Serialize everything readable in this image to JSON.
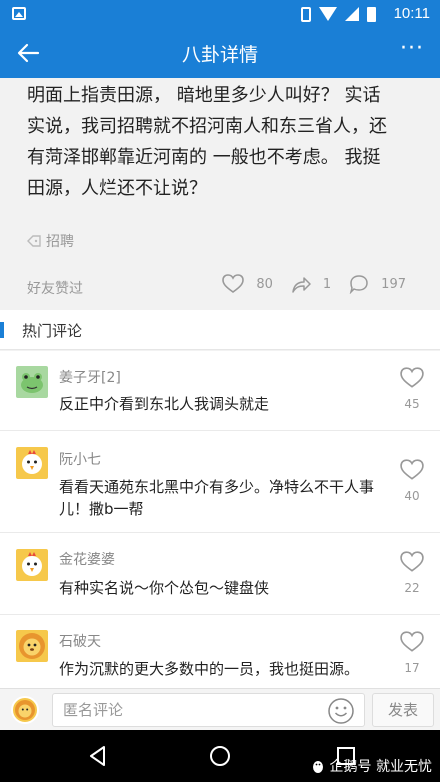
{
  "status_bar": {
    "time": "10:11"
  },
  "app_bar": {
    "title": "八卦详情",
    "more_label": "···"
  },
  "post": {
    "body": "明面上指责田源， 暗地里多少人叫好？ 实话实说，我司招聘就不招河南人和东三省人，还有菏泽邯郸靠近河南的 一般也不考虑。 我挺田源，人烂还不让说？",
    "tag": "招聘",
    "friends_liked": "好友赞过",
    "like_count": "80",
    "share_count": "1",
    "comment_count": "197"
  },
  "hot_comments": {
    "title": "热门评论",
    "items": [
      {
        "name": "姜子牙[2]",
        "text": "反正中介看到东北人我调头就走",
        "likes": "45",
        "avatar": "frog-avatar",
        "avatar_color": "#a8d8a0"
      },
      {
        "name": "阮小七",
        "text": "看看天通苑东北黑中介有多少。净特么不干人事儿！撒b一帮",
        "likes": "40",
        "avatar": "chicken-avatar",
        "avatar_color": "#f6c84b"
      },
      {
        "name": "金花婆婆",
        "text": "有种实名说～你个怂包～键盘侠",
        "likes": "22",
        "avatar": "chicken-avatar",
        "avatar_color": "#f6c84b"
      },
      {
        "name": "石破天",
        "text": "作为沉默的更大多数中的一员，我也挺田源。",
        "likes": "17",
        "avatar": "lion-avatar",
        "avatar_color": "#f6c84b"
      }
    ]
  },
  "input_bar": {
    "placeholder": "匿名评论",
    "send_label": "发表"
  },
  "watermark": {
    "text": "企鹅号 就业无忧"
  },
  "colors": {
    "accent": "#1a7fd6"
  }
}
